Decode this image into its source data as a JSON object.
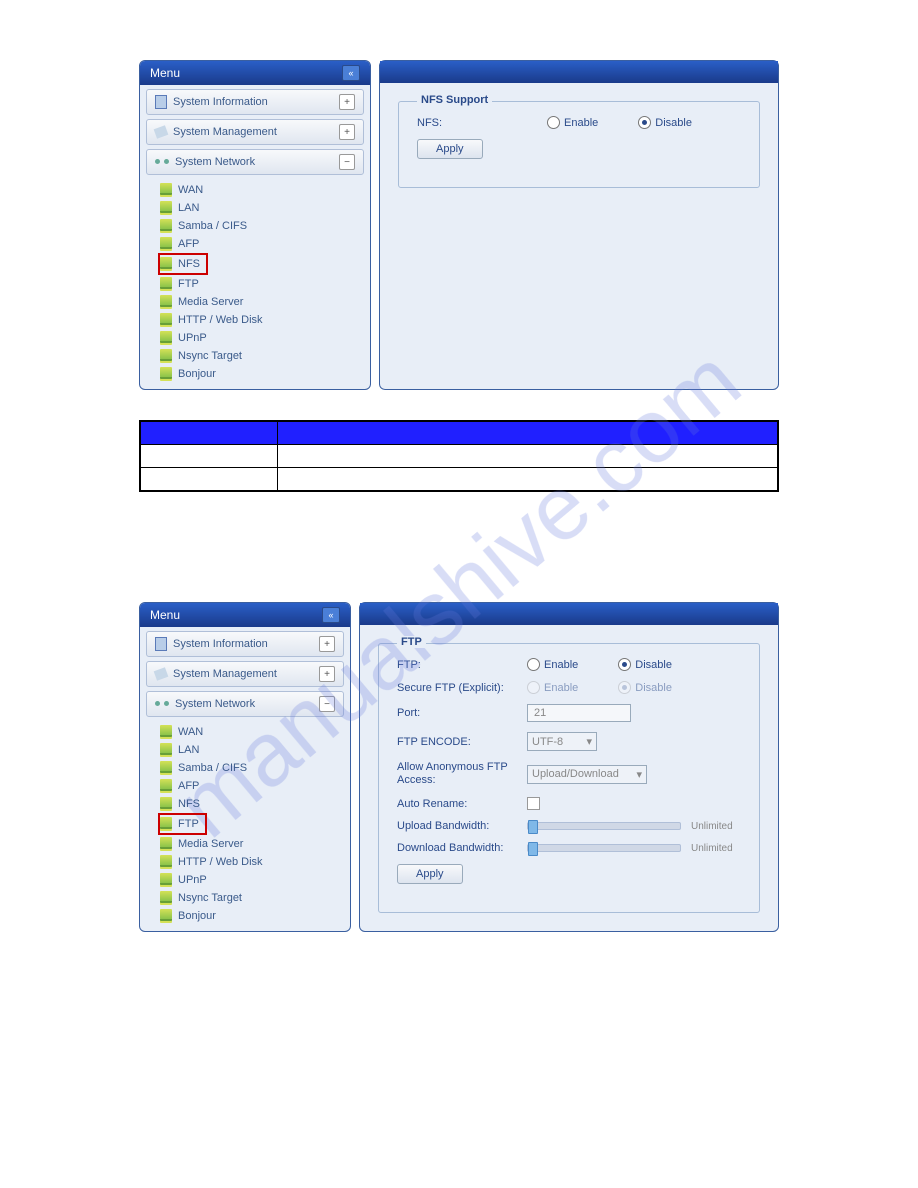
{
  "watermark": "manualshive.com",
  "panel1": {
    "menu_title": "Menu",
    "sections": {
      "sys_info": "System Information",
      "sys_mgmt": "System Management",
      "sys_net": "System Network"
    },
    "tree": [
      "WAN",
      "LAN",
      "Samba / CIFS",
      "AFP",
      "NFS",
      "FTP",
      "Media Server",
      "HTTP / Web Disk",
      "UPnP",
      "Nsync Target",
      "Bonjour"
    ],
    "highlighted": "NFS",
    "content": {
      "legend": "NFS Support",
      "nfs_label": "NFS:",
      "enable": "Enable",
      "disable": "Disable",
      "apply": "Apply"
    }
  },
  "table": {
    "rows": [
      [
        "",
        ""
      ],
      [
        "",
        ""
      ]
    ]
  },
  "panel2": {
    "menu_title": "Menu",
    "sections": {
      "sys_info": "System Information",
      "sys_mgmt": "System Management",
      "sys_net": "System Network"
    },
    "tree": [
      "WAN",
      "LAN",
      "Samba / CIFS",
      "AFP",
      "NFS",
      "FTP",
      "Media Server",
      "HTTP / Web Disk",
      "UPnP",
      "Nsync Target",
      "Bonjour"
    ],
    "highlighted": "FTP",
    "content": {
      "legend": "FTP",
      "ftp_label": "FTP:",
      "secure_label": "Secure FTP (Explicit):",
      "port_label": "Port:",
      "port_value": "21",
      "encode_label": "FTP ENCODE:",
      "encode_value": "UTF-8",
      "anon_label": "Allow Anonymous FTP Access:",
      "anon_value": "Upload/Download",
      "rename_label": "Auto Rename:",
      "upbw_label": "Upload Bandwidth:",
      "dlbw_label": "Download Bandwidth:",
      "unlimited": "Unlimited",
      "enable": "Enable",
      "disable": "Disable",
      "apply": "Apply"
    }
  }
}
